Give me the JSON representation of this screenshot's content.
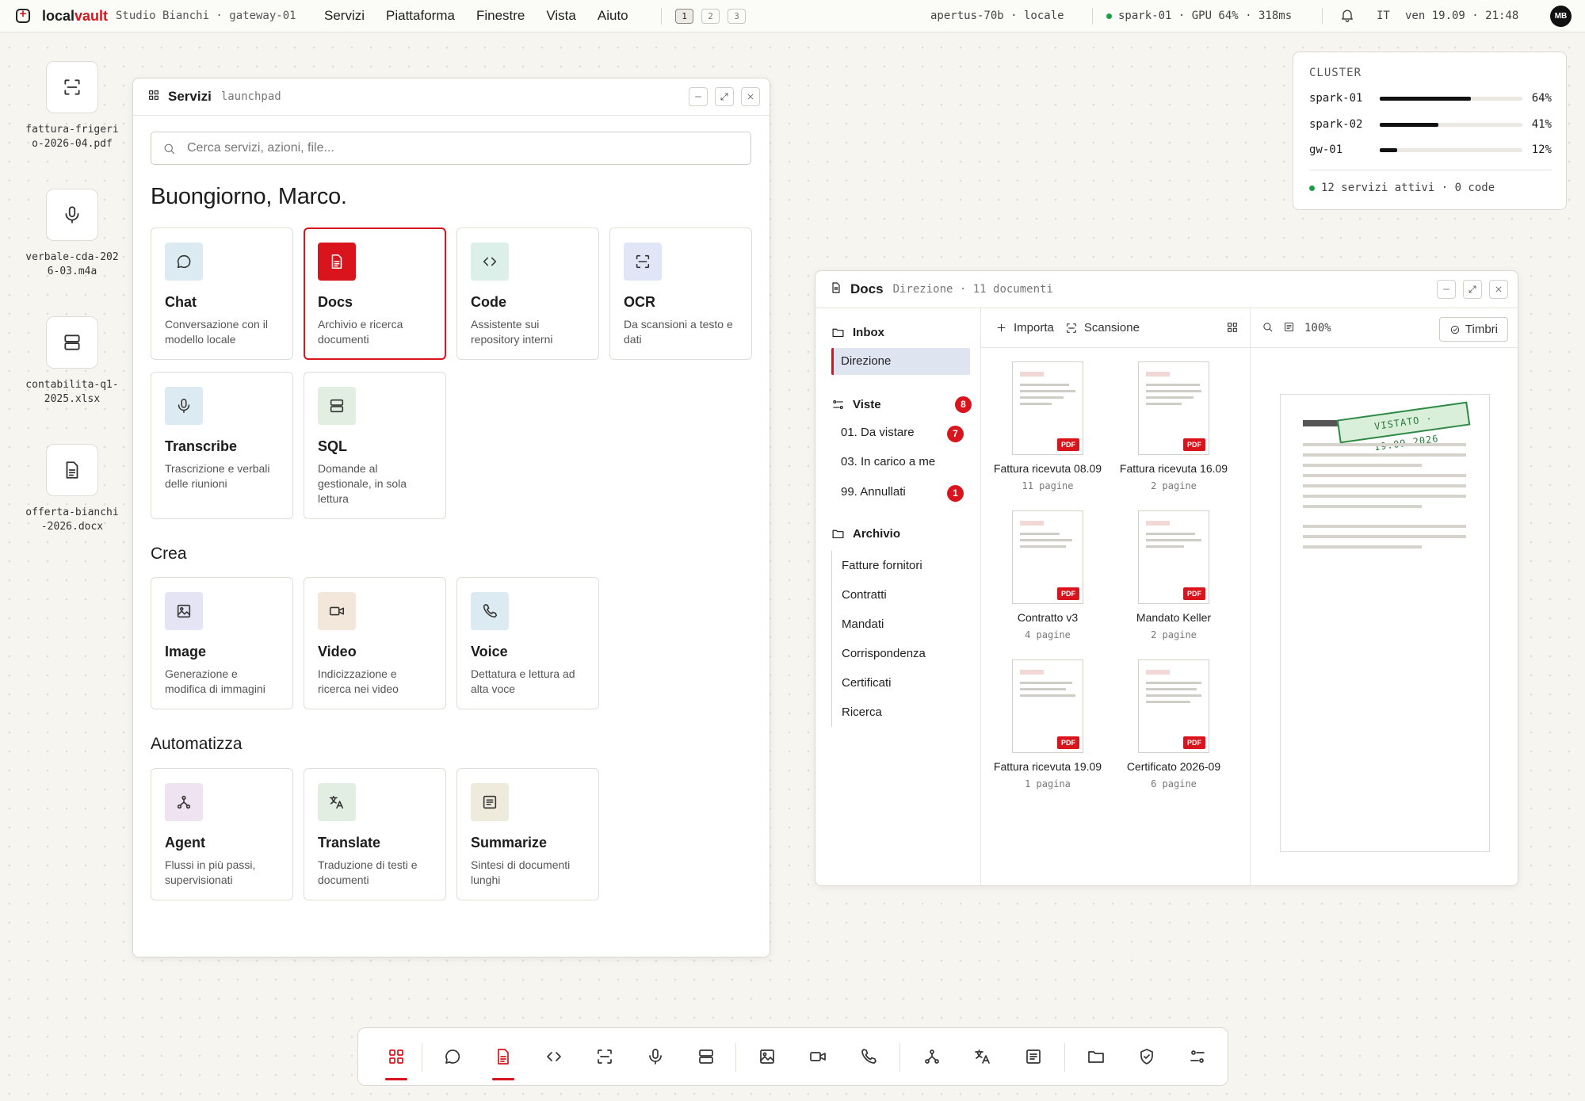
{
  "topbar": {
    "brand_a": "local",
    "brand_b": "vault",
    "org": "Studio Bianchi · gateway-01",
    "menu": [
      "Servizi",
      "Piattaforma",
      "Finestre",
      "Vista",
      "Aiuto"
    ],
    "workspaces": [
      "1",
      "2",
      "3"
    ],
    "active_workspace": "1",
    "model": "apertus-70b · locale",
    "node_status": "spark-01 · GPU 64% · 318ms",
    "language": "IT",
    "datetime": "ven 19.09 · 21:48",
    "avatar": "MB"
  },
  "desktop_files": [
    {
      "name": "fattura-frigerio-2026-04.pdf",
      "icon": "scan-icon"
    },
    {
      "name": "verbale-cda-2026-03.m4a",
      "icon": "mic-icon"
    },
    {
      "name": "contabilita-q1-2025.xlsx",
      "icon": "database-icon"
    },
    {
      "name": "offerta-bianchi-2026.docx",
      "icon": "document-icon"
    }
  ],
  "launchpad": {
    "title": "Servizi",
    "subtitle": "launchpad",
    "search_placeholder": "Cerca servizi, azioni, file...",
    "greeting": "Buongiorno, Marco.",
    "services": [
      {
        "title": "Chat",
        "desc": "Conversazione con il modello locale",
        "icon": "chat-icon",
        "bg": "#dcebf2"
      },
      {
        "title": "Docs",
        "desc": "Archivio e ricerca documenti",
        "icon": "document-icon",
        "bg": "#d9141c",
        "selected": true
      },
      {
        "title": "Code",
        "desc": "Assistente sui repository interni",
        "icon": "code-icon",
        "bg": "#dcefe9"
      },
      {
        "title": "OCR",
        "desc": "Da scansioni a testo e dati",
        "icon": "scan-icon",
        "bg": "#e0e6f6"
      },
      {
        "title": "Transcribe",
        "desc": "Trascrizione e verbali delle riunioni",
        "icon": "mic-icon",
        "bg": "#dcebf2"
      },
      {
        "title": "SQL",
        "desc": "Domande al gestionale, in sola lettura",
        "icon": "database-icon",
        "bg": "#e2eee2"
      }
    ],
    "create_heading": "Crea",
    "create": [
      {
        "title": "Image",
        "desc": "Generazione e modifica di immagini",
        "icon": "image-icon",
        "bg": "#e4e4f4"
      },
      {
        "title": "Video",
        "desc": "Indicizzazione e ricerca nei video",
        "icon": "video-icon",
        "bg": "#f3e6da"
      },
      {
        "title": "Voice",
        "desc": "Dettatura e lettura ad alta voce",
        "icon": "phone-icon",
        "bg": "#dcebf2"
      }
    ],
    "automate_heading": "Automatizza",
    "automate": [
      {
        "title": "Agent",
        "desc": "Flussi in più passi, supervisionati",
        "icon": "agent-icon",
        "bg": "#efe2f1"
      },
      {
        "title": "Translate",
        "desc": "Traduzione di testi e documenti",
        "icon": "translate-icon",
        "bg": "#e2eee2"
      },
      {
        "title": "Summarize",
        "desc": "Sintesi di documenti lunghi",
        "icon": "summary-icon",
        "bg": "#eeeadc"
      }
    ]
  },
  "docs": {
    "title": "Docs",
    "subtitle": "Direzione · 11 documenti",
    "inbox_label": "Inbox",
    "inbox_items": [
      "Direzione"
    ],
    "views_label": "Viste",
    "views_badge": "8",
    "views": [
      {
        "label": "01. Da vistare",
        "badge": "7"
      },
      {
        "label": "03. In carico a me",
        "badge": ""
      },
      {
        "label": "99. Annullati",
        "badge": "1"
      }
    ],
    "archive_label": "Archivio",
    "archive": [
      "Fatture fornitori",
      "Contratti",
      "Mandati",
      "Corrispondenza",
      "Certificati",
      "Ricerca"
    ],
    "import_label": "Importa",
    "scan_label": "Scansione",
    "files": [
      {
        "name": "Fattura ricevuta 08.09",
        "pages": "11 pagine"
      },
      {
        "name": "Fattura ricevuta 16.09",
        "pages": "2 pagine"
      },
      {
        "name": "Contratto v3",
        "pages": "4 pagine"
      },
      {
        "name": "Mandato Keller",
        "pages": "2 pagine"
      },
      {
        "name": "Fattura ricevuta 19.09",
        "pages": "1 pagina"
      },
      {
        "name": "Certificato 2026-09",
        "pages": "6 pagine"
      }
    ],
    "file_badge": "PDF",
    "zoom": "100%",
    "stamps_label": "Timbri",
    "stamp_text": "VISTATO · 19.09.2026"
  },
  "cluster": {
    "title": "CLUSTER",
    "nodes": [
      {
        "name": "spark-01",
        "percent": 64,
        "label": "64%"
      },
      {
        "name": "spark-02",
        "percent": 41,
        "label": "41%"
      },
      {
        "name": "gw-01",
        "percent": 12,
        "label": "12%"
      }
    ],
    "status": "12 servizi attivi · 0 code"
  },
  "colors": {
    "accent": "#d9141c",
    "ok": "#1e9e4a",
    "highlight": "#dfe4f1"
  },
  "dock": [
    "apps-icon",
    "chat-icon",
    "document-icon",
    "code-icon",
    "scan-icon",
    "mic-icon",
    "database-icon",
    "image-icon",
    "video-icon",
    "phone-icon",
    "agent-icon",
    "translate-icon",
    "summary-icon",
    "folder-icon",
    "shield-icon",
    "settings-icon"
  ]
}
